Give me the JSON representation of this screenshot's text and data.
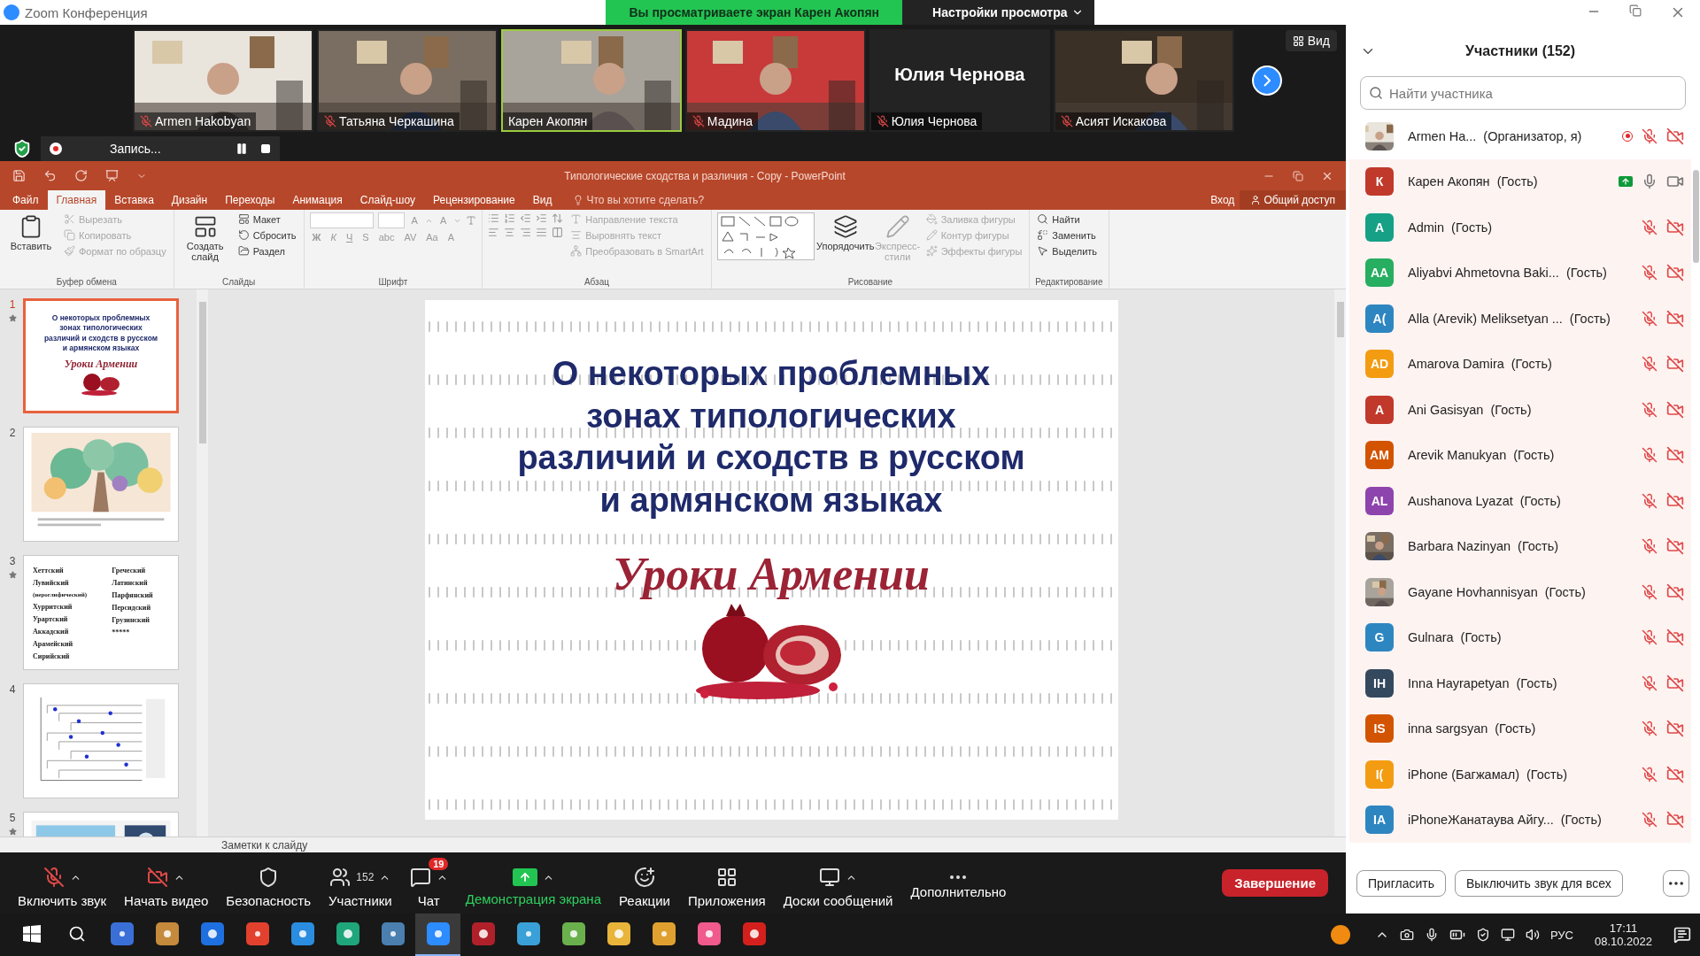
{
  "window": {
    "title": "Zoom Конференция"
  },
  "share_banner": {
    "text": "Вы просматриваете экран Карен Акопян",
    "options": "Настройки просмотра"
  },
  "gallery": {
    "tiles": [
      {
        "name": "Armen Hakobyan",
        "kind": "video",
        "muted": true,
        "speaking": false
      },
      {
        "name": "Татьяна Черкашина",
        "kind": "video",
        "muted": true,
        "speaking": false
      },
      {
        "name": "Карен Акопян",
        "kind": "video",
        "muted": false,
        "speaking": true
      },
      {
        "name": "Мадина",
        "kind": "video",
        "muted": true,
        "speaking": false
      },
      {
        "name": "Юлия Чернова",
        "kind": "name_card",
        "display": "Юлия Чернова",
        "muted": true,
        "speaking": false
      },
      {
        "name": "Асият Искакова",
        "kind": "video",
        "muted": true,
        "speaking": false
      }
    ],
    "view_button": "Вид"
  },
  "recording": {
    "label": "Запись..."
  },
  "powerpoint": {
    "title": "Типологические сходства и различия - Copy - PowerPoint",
    "tabs": [
      {
        "label": "Файл",
        "selected": false
      },
      {
        "label": "Главная",
        "selected": true
      },
      {
        "label": "Вставка",
        "selected": false
      },
      {
        "label": "Дизайн",
        "selected": false
      },
      {
        "label": "Переходы",
        "selected": false
      },
      {
        "label": "Анимация",
        "selected": false
      },
      {
        "label": "Слайд-шоу",
        "selected": false
      },
      {
        "label": "Рецензирование",
        "selected": false
      },
      {
        "label": "Вид",
        "selected": false
      }
    ],
    "tell_me": "Что вы хотите сделать?",
    "sign_in": "Вход",
    "share": "Общий доступ",
    "ribbon": [
      {
        "label": "Буфер обмена",
        "kind": "standard",
        "large": [
          {
            "label": "Вставить",
            "disabled": false
          }
        ],
        "small": [
          {
            "label": "Вырезать",
            "disabled": true
          },
          {
            "label": "Копировать",
            "disabled": true
          },
          {
            "label": "Формат по образцу",
            "disabled": true
          }
        ]
      },
      {
        "label": "Слайды",
        "kind": "standard",
        "large": [
          {
            "label": "Создать слайд",
            "disabled": false
          }
        ],
        "small": [
          {
            "label": "Макет",
            "disabled": false
          },
          {
            "label": "Сбросить",
            "disabled": false
          },
          {
            "label": "Раздел",
            "disabled": false
          }
        ]
      },
      {
        "label": "Шрифт",
        "kind": "font",
        "size_buttons": [
          "A",
          "A"
        ],
        "format_buttons": [
          "Ж",
          "К",
          "Ч",
          "S",
          "abc",
          "AV",
          "Aa",
          "A"
        ]
      },
      {
        "label": "Абзац",
        "kind": "paragraph",
        "small": [
          {
            "label": "Направление текста",
            "disabled": true
          },
          {
            "label": "Выровнять текст",
            "disabled": true
          },
          {
            "label": "Преобразовать в SmartArt",
            "disabled": true
          }
        ]
      },
      {
        "label": "Рисование",
        "kind": "drawing",
        "large": [
          {
            "label": "Упорядочить",
            "disabled": false
          },
          {
            "label": "Экспресс-стили",
            "disabled": true
          }
        ],
        "small": [
          {
            "label": "Заливка фигуры",
            "disabled": true
          },
          {
            "label": "Контур фигуры",
            "disabled": true
          },
          {
            "label": "Эффекты фигуры",
            "disabled": true
          }
        ]
      },
      {
        "label": "Редактирование",
        "kind": "standard",
        "small": [
          {
            "label": "Найти",
            "disabled": false
          },
          {
            "label": "Заменить",
            "disabled": false
          },
          {
            "label": "Выделить",
            "disabled": false
          }
        ]
      }
    ],
    "thumbnails": [
      {
        "number": "1",
        "selected": true,
        "starred": true,
        "kind": "title",
        "title": "О некоторых проблемных\nзонах типологических\nразличий и сходств в русском\nи армянском языках",
        "subtitle": "Уроки Армении"
      },
      {
        "number": "2",
        "selected": false,
        "starred": false,
        "kind": "picture"
      },
      {
        "number": "3",
        "selected": false,
        "starred": true,
        "kind": "list",
        "columns": [
          [
            "Хеттский",
            "Лувийский",
            "(иероглифический)",
            "Хурритский",
            "Урартский",
            "Аккадский",
            "Арамейский",
            "Сирийский"
          ],
          [
            "Греческий",
            "Латинский",
            "Парфянский",
            "Персидский",
            "Грузинский",
            "*****"
          ]
        ]
      },
      {
        "number": "4",
        "selected": false,
        "starred": false,
        "kind": "chart"
      },
      {
        "number": "5",
        "selected": false,
        "starred": true,
        "kind": "picture"
      }
    ],
    "slide": {
      "title": "О некоторых проблемных\nзонах типологических\nразличий и сходств в русском\nи армянском языках",
      "subtitle": "Уроки Армении"
    },
    "notes": "Заметки к слайду"
  },
  "toolbar": {
    "items": [
      {
        "label": "Включить звук",
        "caret": true,
        "highlighted": false
      },
      {
        "label": "Начать видео",
        "caret": true,
        "highlighted": false
      },
      {
        "label": "Безопасность",
        "caret": false,
        "highlighted": false
      },
      {
        "label": "Участники",
        "caret": true,
        "count": "152",
        "highlighted": false
      },
      {
        "label": "Чат",
        "caret": true,
        "badge": "19",
        "highlighted": false
      },
      {
        "label": "Демонстрация экрана",
        "caret": true,
        "highlighted": true
      },
      {
        "label": "Реакции",
        "caret": false,
        "highlighted": false
      },
      {
        "label": "Приложения",
        "caret": false,
        "highlighted": false
      },
      {
        "label": "Доски сообщений",
        "caret": true,
        "highlighted": false
      },
      {
        "label": "Дополнительно",
        "caret": false,
        "highlighted": false
      }
    ],
    "end": "Завершение"
  },
  "participants": {
    "title": "Участники (152)",
    "search_placeholder": "Найти участника",
    "list": [
      {
        "name": "Armen Ha...",
        "role": "(Организатор, я)",
        "recording": true,
        "muted": true,
        "video_off": true,
        "highlighted": false
      },
      {
        "name": "Карен Акопян",
        "role": "(Гость)",
        "kind": "initials",
        "initials": "К",
        "color": "#c0392b",
        "sharing": true,
        "muted": false,
        "video_off": false,
        "highlighted": true
      },
      {
        "name": "Admin",
        "role": "(Гость)",
        "kind": "initials",
        "initials": "A",
        "color": "#16a085",
        "muted": true,
        "video_off": true,
        "highlighted": true
      },
      {
        "name": "Aliyabvi Ahmetovna Baki...",
        "role": "(Гость)",
        "kind": "initials",
        "initials": "AA",
        "color": "#27ae60",
        "muted": true,
        "video_off": true,
        "highlighted": true
      },
      {
        "name": "Alla (Arevik) Meliksetyan ...",
        "role": "(Гость)",
        "kind": "initials",
        "initials": "A(",
        "color": "#2e86c1",
        "muted": true,
        "video_off": true,
        "highlighted": true
      },
      {
        "name": "Amarova Damira",
        "role": "(Гость)",
        "kind": "initials",
        "initials": "AD",
        "color": "#f39c12",
        "muted": true,
        "video_off": true,
        "highlighted": true
      },
      {
        "name": "Ani Gasisyan",
        "role": "(Гость)",
        "kind": "initials",
        "initials": "A",
        "color": "#c0392b",
        "muted": true,
        "video_off": true,
        "highlighted": true
      },
      {
        "name": "Arevik Manukyan",
        "role": "(Гость)",
        "kind": "initials",
        "initials": "AM",
        "color": "#d35400",
        "muted": true,
        "video_off": true,
        "highlighted": true
      },
      {
        "name": "Aushanova Lyazat",
        "role": "(Гость)",
        "kind": "initials",
        "initials": "AL",
        "color": "#8e44ad",
        "muted": true,
        "video_off": true,
        "highlighted": true
      },
      {
        "name": "Barbara Nazinyan",
        "role": "(Гость)",
        "muted": true,
        "video_off": true,
        "highlighted": true
      },
      {
        "name": "Gayane Hovhannisyan",
        "role": "(Гость)",
        "muted": true,
        "video_off": true,
        "highlighted": true
      },
      {
        "name": "Gulnara",
        "role": "(Гость)",
        "kind": "initials",
        "initials": "G",
        "color": "#2e86c1",
        "muted": true,
        "video_off": true,
        "highlighted": true
      },
      {
        "name": "Inna Hayrapetyan",
        "role": "(Гость)",
        "kind": "initials",
        "initials": "IH",
        "color": "#34495e",
        "muted": true,
        "video_off": true,
        "highlighted": true
      },
      {
        "name": "inna sargsyan",
        "role": "(Гость)",
        "kind": "initials",
        "initials": "IS",
        "color": "#d35400",
        "muted": true,
        "video_off": true,
        "highlighted": true
      },
      {
        "name": "iPhone (Багжамал)",
        "role": "(Гость)",
        "kind": "initials",
        "initials": "I(",
        "color": "#f39c12",
        "muted": true,
        "video_off": true,
        "highlighted": true
      },
      {
        "name": "iPhoneЖанатаува Айгу...",
        "role": "(Гость)",
        "kind": "initials",
        "initials": "IA",
        "color": "#2e86c1",
        "muted": true,
        "video_off": true,
        "highlighted": true
      }
    ],
    "buttons": [
      "Пригласить",
      "Выключить звук для всех"
    ]
  },
  "taskbar": {
    "apps": [
      {
        "color": "#3b6fd8",
        "selected": false
      },
      {
        "color": "#c58a3c",
        "selected": false
      },
      {
        "color": "#1e6fe0",
        "selected": false
      },
      {
        "color": "#e2412e",
        "selected": false
      },
      {
        "color": "#2a8de0",
        "selected": false
      },
      {
        "color": "#1fa67a",
        "selected": false
      },
      {
        "color": "#4a7fb0",
        "selected": false
      },
      {
        "color": "#2d8cff",
        "selected": true
      },
      {
        "color": "#b0202a",
        "selected": false
      },
      {
        "color": "#3aa0d8",
        "selected": false
      },
      {
        "color": "#6ab04c",
        "selected": false
      },
      {
        "color": "#e8b43a",
        "selected": false
      },
      {
        "color": "#e0a030",
        "selected": false
      },
      {
        "color": "#f05a8c",
        "selected": false
      },
      {
        "color": "#d4201c",
        "selected": false
      }
    ],
    "language": "РУС",
    "time": "17:11",
    "date": "08.10.2022"
  }
}
